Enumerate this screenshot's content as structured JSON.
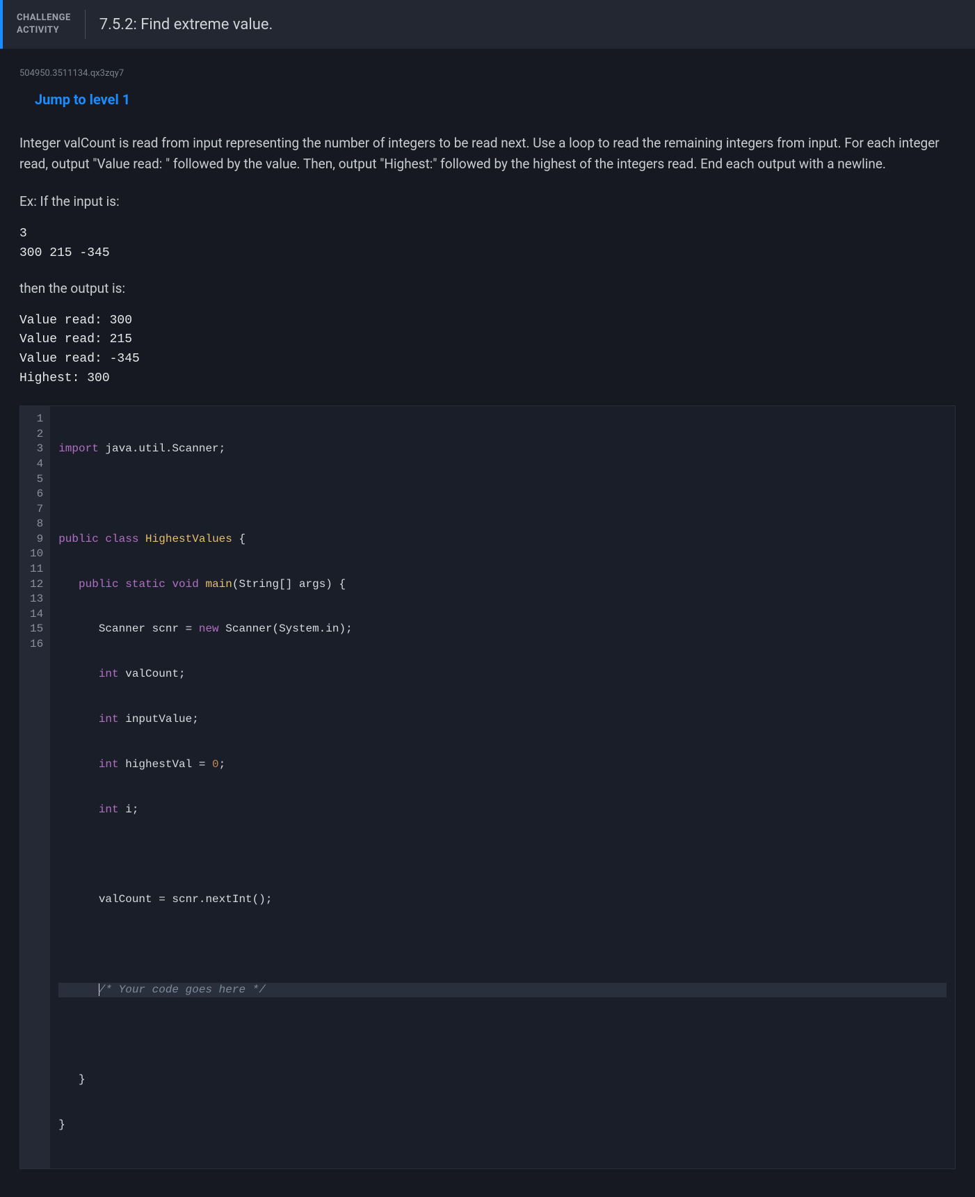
{
  "header": {
    "label_line1": "CHALLENGE",
    "label_line2": "ACTIVITY",
    "title": "7.5.2: Find extreme value."
  },
  "reference_id": "504950.3511134.qx3zqy7",
  "jump_link": "Jump to level 1",
  "prompt": "Integer valCount is read from input representing the number of integers to be read next. Use a loop to read the remaining integers from input. For each integer read, output \"Value read: \" followed by the value. Then, output \"Highest:\" followed by the highest of the integers read. End each output with a newline.",
  "example_intro": "Ex: If the input is:",
  "example_input": "3\n300 215 -345",
  "example_output_intro": "then the output is:",
  "example_output": "Value read: 300\nValue read: 215\nValue read: -345\nHighest: 300",
  "code": {
    "line_count": 16,
    "lines": {
      "l1": {
        "kw": "import",
        "rest": " java.util.Scanner;"
      },
      "l3": {
        "kw1": "public",
        "kw2": "class",
        "name": "HighestValues",
        "brace": " {"
      },
      "l4": {
        "indent": "   ",
        "kw1": "public",
        "kw2": "static",
        "kw3": "void",
        "fn": "main",
        "params": "(String[] args) {"
      },
      "l5": {
        "indent": "      ",
        "type": "Scanner",
        "mid": " scnr = ",
        "new": "new",
        "cls": " Scanner",
        "args": "(System.in);"
      },
      "l6": {
        "indent": "      ",
        "type": "int",
        "rest": " valCount;"
      },
      "l7": {
        "indent": "      ",
        "type": "int",
        "rest": " inputValue;"
      },
      "l8": {
        "indent": "      ",
        "type": "int",
        "mid": " highestVal = ",
        "num": "0",
        "end": ";"
      },
      "l9": {
        "indent": "      ",
        "type": "int",
        "rest": " i;"
      },
      "l11": {
        "indent": "      ",
        "text": "valCount = scnr.nextInt();"
      },
      "l13": {
        "indent": "      ",
        "comment": "/* Your code goes here */"
      },
      "l15": {
        "indent": "   ",
        "text": "}"
      },
      "l16": {
        "text": "}"
      }
    }
  }
}
